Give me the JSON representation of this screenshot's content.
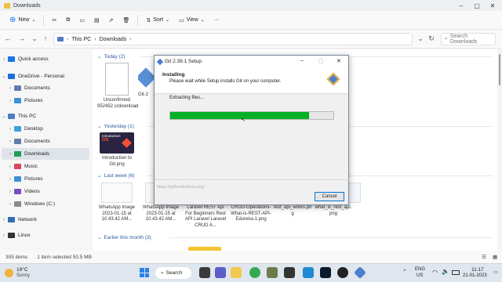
{
  "window": {
    "title": "Downloads"
  },
  "toolbar": {
    "new_label": "New",
    "sort_label": "Sort",
    "view_label": "View",
    "more_label": "···"
  },
  "address": {
    "segments": [
      "This PC",
      "Downloads"
    ],
    "search_placeholder": "Search Downloads"
  },
  "sidebar": {
    "items": [
      {
        "label": "Quick access",
        "color": "#1a73e8"
      },
      {
        "label": "OneDrive - Personal",
        "color": "#1e6fd9"
      },
      {
        "label": "Documents",
        "color": "#5f7fa6"
      },
      {
        "label": "Pictures",
        "color": "#3d8fd6"
      },
      {
        "label": "This PC",
        "color": "#4d7cc2"
      },
      {
        "label": "Desktop",
        "color": "#3ba0e0"
      },
      {
        "label": "Documents",
        "color": "#5f7fa6"
      },
      {
        "label": "Downloads",
        "color": "#1f9d55"
      },
      {
        "label": "Music",
        "color": "#d9475a"
      },
      {
        "label": "Pictures",
        "color": "#3d8fd6"
      },
      {
        "label": "Videos",
        "color": "#7a4cc2"
      },
      {
        "label": "Windows (C:)",
        "color": "#8a8a8a"
      },
      {
        "label": "Network",
        "color": "#2f6db5"
      },
      {
        "label": "Linux",
        "color": "#333333"
      }
    ]
  },
  "groups": {
    "today": "Today (2)",
    "yesterday": "Yesterday (1)",
    "last_week": "Last week (6)",
    "earlier": "Earlier this month (3)"
  },
  "files": {
    "today": [
      {
        "name": "Unconfirmed 952452.crdownload"
      },
      {
        "name": "Git-2"
      }
    ],
    "yesterday": [
      {
        "name": "Introduction to Git.png"
      }
    ],
    "last_week": [
      {
        "name": "WhatsApp Image 2023-01-15 at 10.43.42 AM..."
      },
      {
        "name": "WhatsApp Image 2023-01-15 at 10.43.42 AM..."
      },
      {
        "name": "Laravel REST Api For Beginners Rest API Laravel Laravel CRUD A..."
      },
      {
        "name": "CRUD-Operations-What-is-REST-API-Edureka-1.png"
      },
      {
        "name": "rest_api_works.png"
      },
      {
        "name": "what_is_rest_api.png"
      }
    ]
  },
  "thumb_text": {
    "intro": "Introduction",
    "git": "Git"
  },
  "statusbar": {
    "count": "305 items",
    "selected": "1 item selected  50.5 MB"
  },
  "dialog": {
    "title": "Git 2.39.1 Setup",
    "heading": "Installing",
    "subheading": "Please wait while Setup installs Git on your computer.",
    "status": "Extracting files...",
    "progress": 0.85,
    "footer_url": "https://gitforwindows.org/",
    "cancel_label": "Cancel"
  },
  "taskbar": {
    "weather_temp": "19°C",
    "weather_desc": "Sunny",
    "search_label": "Search",
    "lang1": "ENG",
    "lang2": "US",
    "time": "11:17",
    "date": "21-01-2023"
  }
}
